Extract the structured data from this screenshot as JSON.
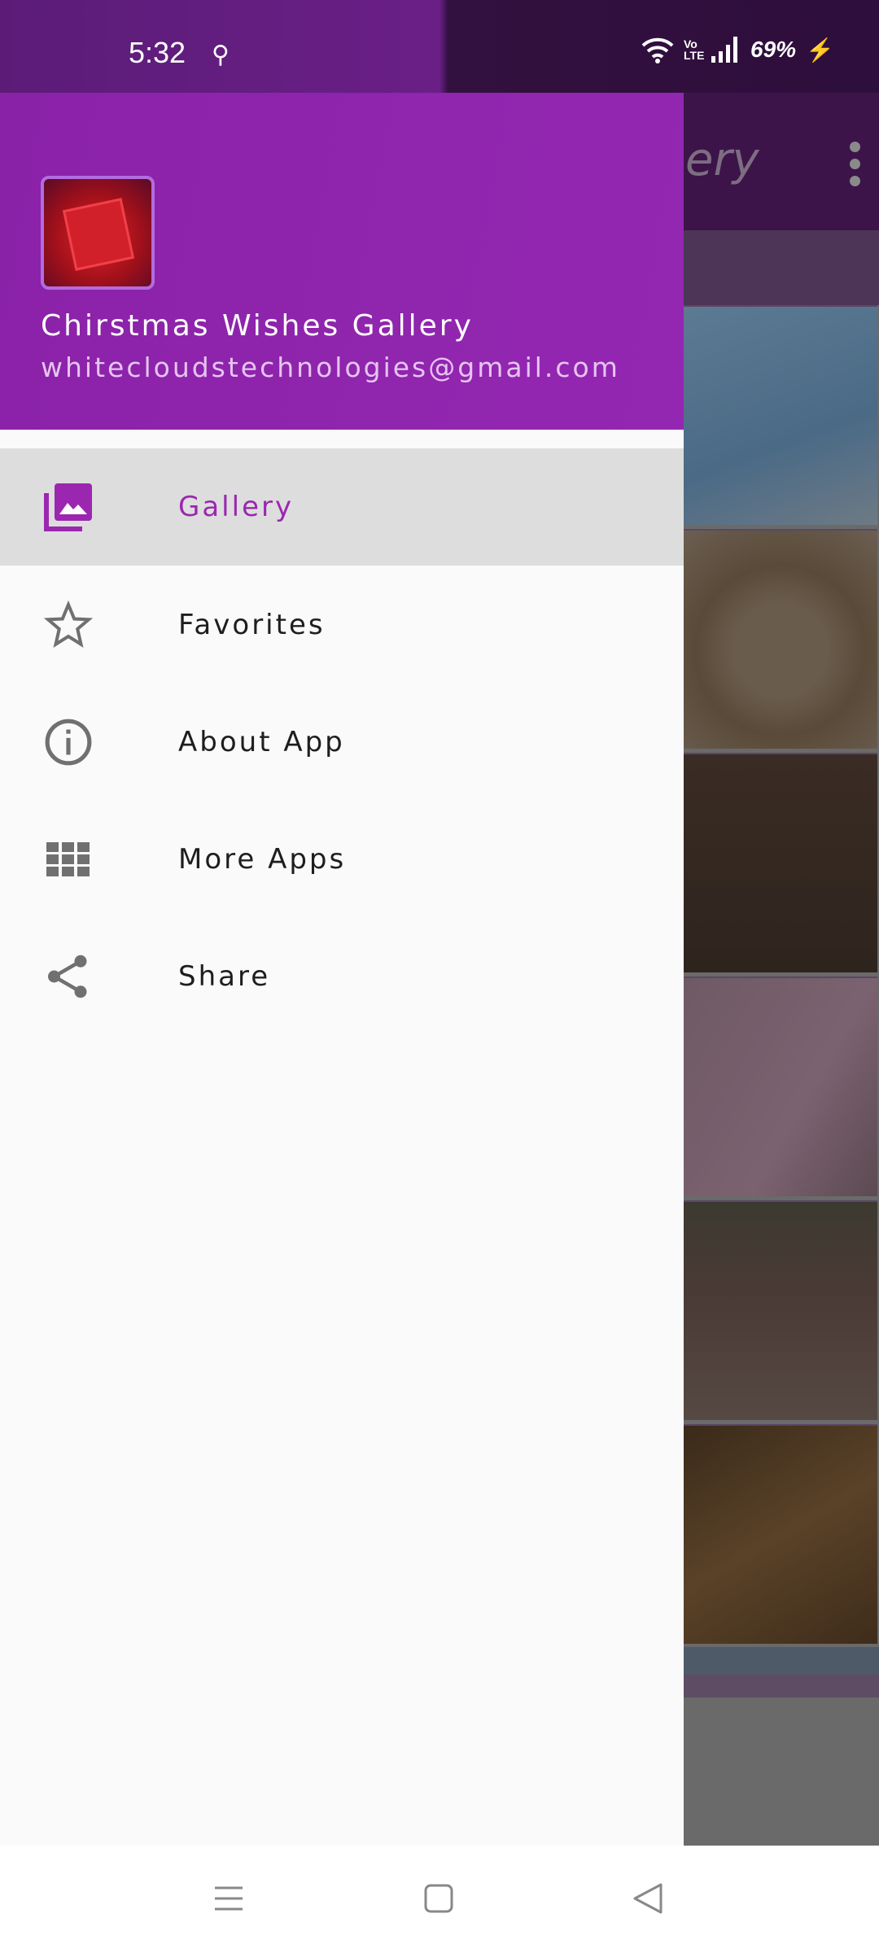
{
  "status_bar": {
    "time": "5:32",
    "battery": "69%",
    "network": "Vo LTE",
    "icons": [
      "key-icon",
      "wifi-icon",
      "volte-icon",
      "signal-icon",
      "charging-icon"
    ]
  },
  "background_app": {
    "toolbar_title_partial": "ery",
    "overflow_icon": "more-vert-icon"
  },
  "drawer": {
    "header": {
      "app_title": "Chirstmas Wishes Gallery",
      "email": "whitecloudstechnologies@gmail.com",
      "color": "#9026ae"
    },
    "items": [
      {
        "label": "Gallery",
        "icon": "photo-library-icon",
        "selected": true
      },
      {
        "label": "Favorites",
        "icon": "star-outline-icon",
        "selected": false
      },
      {
        "label": "About App",
        "icon": "info-icon",
        "selected": false
      },
      {
        "label": "More Apps",
        "icon": "apps-grid-icon",
        "selected": false
      },
      {
        "label": "Share",
        "icon": "share-icon",
        "selected": false
      }
    ],
    "accent": "#9b27b0"
  },
  "nav_bar": {
    "buttons": [
      "menu-icon",
      "home-icon",
      "back-icon"
    ]
  }
}
